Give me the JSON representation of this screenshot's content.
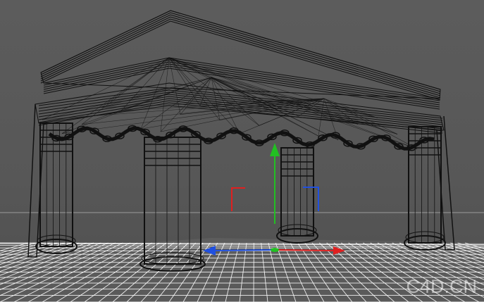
{
  "viewport": {
    "view": "perspective",
    "render_mode": "wireframe",
    "background_color": "#5a5a5a",
    "floor_grid_color": "#ffffff",
    "horizon_line_color": "#9a9a9a",
    "wire_color": "#111111"
  },
  "axis_gizmo": {
    "x_color": "#e02020",
    "y_color": "#22c022",
    "z_color": "#2050e0"
  },
  "icons": {
    "move_handle": "move-gizmo-icon",
    "x_axis": "x-axis-arrow-icon",
    "y_axis": "y-axis-arrow-icon",
    "z_axis": "z-axis-arrow-icon"
  },
  "watermark": {
    "text": "C4D.CN"
  }
}
